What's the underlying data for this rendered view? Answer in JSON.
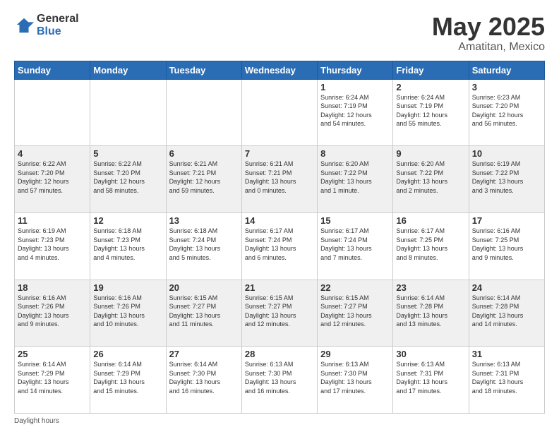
{
  "logo": {
    "general": "General",
    "blue": "Blue"
  },
  "title": "May 2025",
  "subtitle": "Amatitan, Mexico",
  "days_header": [
    "Sunday",
    "Monday",
    "Tuesday",
    "Wednesday",
    "Thursday",
    "Friday",
    "Saturday"
  ],
  "footer": "Daylight hours",
  "weeks": [
    [
      {
        "day": "",
        "info": ""
      },
      {
        "day": "",
        "info": ""
      },
      {
        "day": "",
        "info": ""
      },
      {
        "day": "",
        "info": ""
      },
      {
        "day": "1",
        "info": "Sunrise: 6:24 AM\nSunset: 7:19 PM\nDaylight: 12 hours\nand 54 minutes."
      },
      {
        "day": "2",
        "info": "Sunrise: 6:24 AM\nSunset: 7:19 PM\nDaylight: 12 hours\nand 55 minutes."
      },
      {
        "day": "3",
        "info": "Sunrise: 6:23 AM\nSunset: 7:20 PM\nDaylight: 12 hours\nand 56 minutes."
      }
    ],
    [
      {
        "day": "4",
        "info": "Sunrise: 6:22 AM\nSunset: 7:20 PM\nDaylight: 12 hours\nand 57 minutes."
      },
      {
        "day": "5",
        "info": "Sunrise: 6:22 AM\nSunset: 7:20 PM\nDaylight: 12 hours\nand 58 minutes."
      },
      {
        "day": "6",
        "info": "Sunrise: 6:21 AM\nSunset: 7:21 PM\nDaylight: 12 hours\nand 59 minutes."
      },
      {
        "day": "7",
        "info": "Sunrise: 6:21 AM\nSunset: 7:21 PM\nDaylight: 13 hours\nand 0 minutes."
      },
      {
        "day": "8",
        "info": "Sunrise: 6:20 AM\nSunset: 7:22 PM\nDaylight: 13 hours\nand 1 minute."
      },
      {
        "day": "9",
        "info": "Sunrise: 6:20 AM\nSunset: 7:22 PM\nDaylight: 13 hours\nand 2 minutes."
      },
      {
        "day": "10",
        "info": "Sunrise: 6:19 AM\nSunset: 7:22 PM\nDaylight: 13 hours\nand 3 minutes."
      }
    ],
    [
      {
        "day": "11",
        "info": "Sunrise: 6:19 AM\nSunset: 7:23 PM\nDaylight: 13 hours\nand 4 minutes."
      },
      {
        "day": "12",
        "info": "Sunrise: 6:18 AM\nSunset: 7:23 PM\nDaylight: 13 hours\nand 4 minutes."
      },
      {
        "day": "13",
        "info": "Sunrise: 6:18 AM\nSunset: 7:24 PM\nDaylight: 13 hours\nand 5 minutes."
      },
      {
        "day": "14",
        "info": "Sunrise: 6:17 AM\nSunset: 7:24 PM\nDaylight: 13 hours\nand 6 minutes."
      },
      {
        "day": "15",
        "info": "Sunrise: 6:17 AM\nSunset: 7:24 PM\nDaylight: 13 hours\nand 7 minutes."
      },
      {
        "day": "16",
        "info": "Sunrise: 6:17 AM\nSunset: 7:25 PM\nDaylight: 13 hours\nand 8 minutes."
      },
      {
        "day": "17",
        "info": "Sunrise: 6:16 AM\nSunset: 7:25 PM\nDaylight: 13 hours\nand 9 minutes."
      }
    ],
    [
      {
        "day": "18",
        "info": "Sunrise: 6:16 AM\nSunset: 7:26 PM\nDaylight: 13 hours\nand 9 minutes."
      },
      {
        "day": "19",
        "info": "Sunrise: 6:16 AM\nSunset: 7:26 PM\nDaylight: 13 hours\nand 10 minutes."
      },
      {
        "day": "20",
        "info": "Sunrise: 6:15 AM\nSunset: 7:27 PM\nDaylight: 13 hours\nand 11 minutes."
      },
      {
        "day": "21",
        "info": "Sunrise: 6:15 AM\nSunset: 7:27 PM\nDaylight: 13 hours\nand 12 minutes."
      },
      {
        "day": "22",
        "info": "Sunrise: 6:15 AM\nSunset: 7:27 PM\nDaylight: 13 hours\nand 12 minutes."
      },
      {
        "day": "23",
        "info": "Sunrise: 6:14 AM\nSunset: 7:28 PM\nDaylight: 13 hours\nand 13 minutes."
      },
      {
        "day": "24",
        "info": "Sunrise: 6:14 AM\nSunset: 7:28 PM\nDaylight: 13 hours\nand 14 minutes."
      }
    ],
    [
      {
        "day": "25",
        "info": "Sunrise: 6:14 AM\nSunset: 7:29 PM\nDaylight: 13 hours\nand 14 minutes."
      },
      {
        "day": "26",
        "info": "Sunrise: 6:14 AM\nSunset: 7:29 PM\nDaylight: 13 hours\nand 15 minutes."
      },
      {
        "day": "27",
        "info": "Sunrise: 6:14 AM\nSunset: 7:30 PM\nDaylight: 13 hours\nand 16 minutes."
      },
      {
        "day": "28",
        "info": "Sunrise: 6:13 AM\nSunset: 7:30 PM\nDaylight: 13 hours\nand 16 minutes."
      },
      {
        "day": "29",
        "info": "Sunrise: 6:13 AM\nSunset: 7:30 PM\nDaylight: 13 hours\nand 17 minutes."
      },
      {
        "day": "30",
        "info": "Sunrise: 6:13 AM\nSunset: 7:31 PM\nDaylight: 13 hours\nand 17 minutes."
      },
      {
        "day": "31",
        "info": "Sunrise: 6:13 AM\nSunset: 7:31 PM\nDaylight: 13 hours\nand 18 minutes."
      }
    ]
  ]
}
